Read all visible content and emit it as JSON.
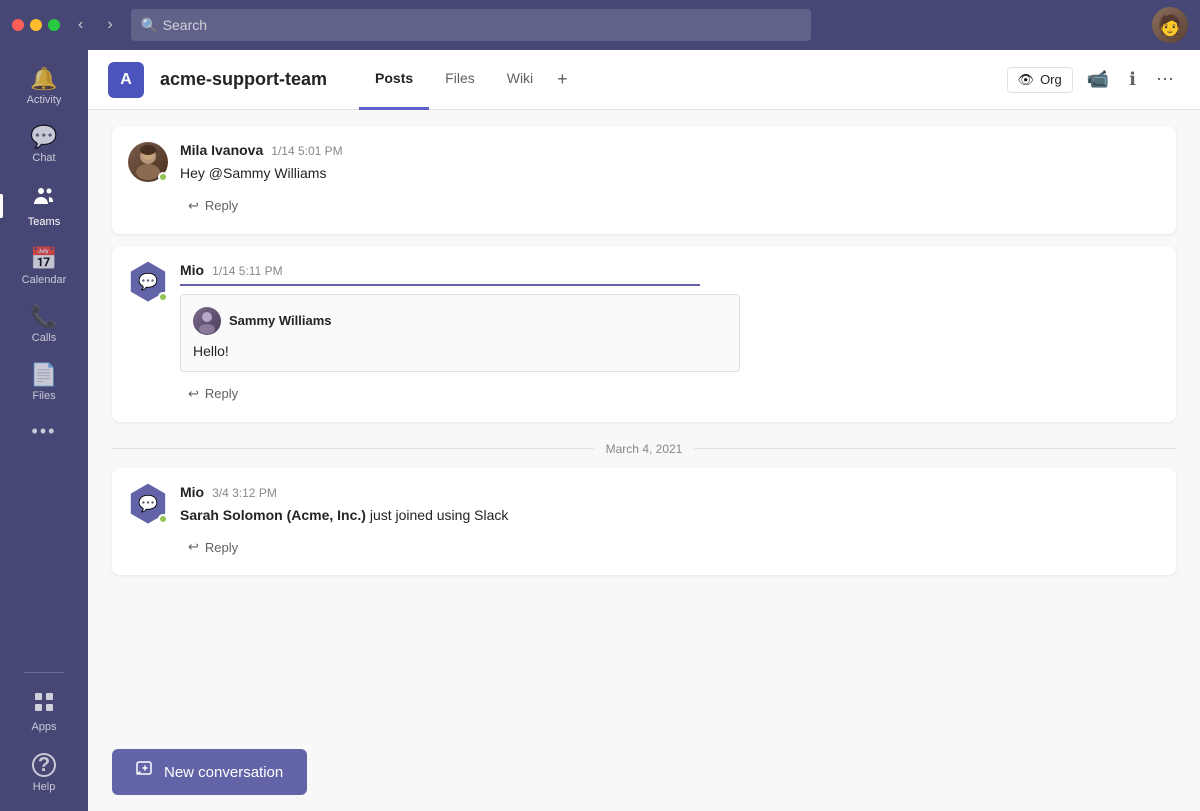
{
  "titlebar": {
    "search_placeholder": "Search"
  },
  "sidebar": {
    "items": [
      {
        "id": "activity",
        "label": "Activity",
        "icon": "🔔",
        "active": false
      },
      {
        "id": "chat",
        "label": "Chat",
        "icon": "💬",
        "active": false
      },
      {
        "id": "teams",
        "label": "Teams",
        "icon": "👥",
        "active": true
      },
      {
        "id": "calendar",
        "label": "Calendar",
        "icon": "📅",
        "active": false
      },
      {
        "id": "calls",
        "label": "Calls",
        "icon": "📞",
        "active": false
      },
      {
        "id": "files",
        "label": "Files",
        "icon": "📄",
        "active": false
      },
      {
        "id": "more",
        "label": "...",
        "icon": "···",
        "active": false
      }
    ],
    "bottom_items": [
      {
        "id": "apps",
        "label": "Apps",
        "icon": "⊞",
        "active": false
      },
      {
        "id": "help",
        "label": "Help",
        "icon": "?",
        "active": false
      }
    ]
  },
  "channel": {
    "icon_letter": "A",
    "name": "acme-support-team",
    "tabs": [
      {
        "id": "posts",
        "label": "Posts",
        "active": true
      },
      {
        "id": "files",
        "label": "Files",
        "active": false
      },
      {
        "id": "wiki",
        "label": "Wiki",
        "active": false
      }
    ],
    "actions": {
      "org_label": "Org",
      "video_icon": "📹",
      "info_icon": "ℹ",
      "more_icon": "⋯"
    }
  },
  "messages": [
    {
      "id": "msg1",
      "author": "Mila Ivanova",
      "time": "1/14 5:01 PM",
      "text": "Hey @Sammy Williams",
      "avatar_type": "mila",
      "reply_label": "Reply"
    },
    {
      "id": "msg2",
      "author": "Mio",
      "time": "1/14 5:11 PM",
      "quoted_user": "Sammy Williams",
      "quoted_text": "Hello!",
      "avatar_type": "mio",
      "reply_label": "Reply"
    }
  ],
  "date_divider": "March 4, 2021",
  "messages2": [
    {
      "id": "msg3",
      "author": "Mio",
      "time": "3/4 3:12 PM",
      "text_bold": "Sarah Solomon (Acme, Inc.)",
      "text_rest": " just joined using Slack",
      "avatar_type": "mio",
      "reply_label": "Reply"
    }
  ],
  "compose": {
    "new_conversation_label": "New conversation"
  }
}
